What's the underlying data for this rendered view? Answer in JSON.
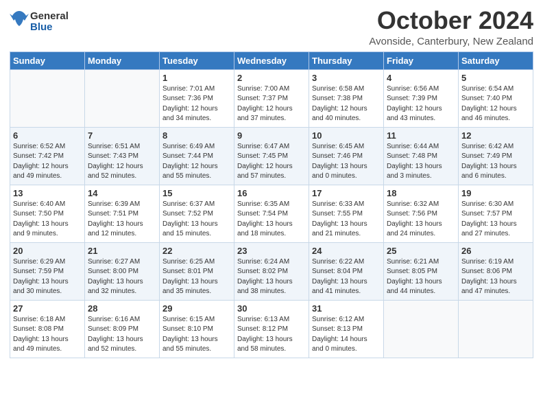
{
  "logo": {
    "text_general": "General",
    "text_blue": "Blue"
  },
  "header": {
    "month": "October 2024",
    "location": "Avonside, Canterbury, New Zealand"
  },
  "weekdays": [
    "Sunday",
    "Monday",
    "Tuesday",
    "Wednesday",
    "Thursday",
    "Friday",
    "Saturday"
  ],
  "weeks": [
    [
      {
        "day": "",
        "sunrise": "",
        "sunset": "",
        "daylight": ""
      },
      {
        "day": "",
        "sunrise": "",
        "sunset": "",
        "daylight": ""
      },
      {
        "day": "1",
        "sunrise": "Sunrise: 7:01 AM",
        "sunset": "Sunset: 7:36 PM",
        "daylight": "Daylight: 12 hours and 34 minutes."
      },
      {
        "day": "2",
        "sunrise": "Sunrise: 7:00 AM",
        "sunset": "Sunset: 7:37 PM",
        "daylight": "Daylight: 12 hours and 37 minutes."
      },
      {
        "day": "3",
        "sunrise": "Sunrise: 6:58 AM",
        "sunset": "Sunset: 7:38 PM",
        "daylight": "Daylight: 12 hours and 40 minutes."
      },
      {
        "day": "4",
        "sunrise": "Sunrise: 6:56 AM",
        "sunset": "Sunset: 7:39 PM",
        "daylight": "Daylight: 12 hours and 43 minutes."
      },
      {
        "day": "5",
        "sunrise": "Sunrise: 6:54 AM",
        "sunset": "Sunset: 7:40 PM",
        "daylight": "Daylight: 12 hours and 46 minutes."
      }
    ],
    [
      {
        "day": "6",
        "sunrise": "Sunrise: 6:52 AM",
        "sunset": "Sunset: 7:42 PM",
        "daylight": "Daylight: 12 hours and 49 minutes."
      },
      {
        "day": "7",
        "sunrise": "Sunrise: 6:51 AM",
        "sunset": "Sunset: 7:43 PM",
        "daylight": "Daylight: 12 hours and 52 minutes."
      },
      {
        "day": "8",
        "sunrise": "Sunrise: 6:49 AM",
        "sunset": "Sunset: 7:44 PM",
        "daylight": "Daylight: 12 hours and 55 minutes."
      },
      {
        "day": "9",
        "sunrise": "Sunrise: 6:47 AM",
        "sunset": "Sunset: 7:45 PM",
        "daylight": "Daylight: 12 hours and 57 minutes."
      },
      {
        "day": "10",
        "sunrise": "Sunrise: 6:45 AM",
        "sunset": "Sunset: 7:46 PM",
        "daylight": "Daylight: 13 hours and 0 minutes."
      },
      {
        "day": "11",
        "sunrise": "Sunrise: 6:44 AM",
        "sunset": "Sunset: 7:48 PM",
        "daylight": "Daylight: 13 hours and 3 minutes."
      },
      {
        "day": "12",
        "sunrise": "Sunrise: 6:42 AM",
        "sunset": "Sunset: 7:49 PM",
        "daylight": "Daylight: 13 hours and 6 minutes."
      }
    ],
    [
      {
        "day": "13",
        "sunrise": "Sunrise: 6:40 AM",
        "sunset": "Sunset: 7:50 PM",
        "daylight": "Daylight: 13 hours and 9 minutes."
      },
      {
        "day": "14",
        "sunrise": "Sunrise: 6:39 AM",
        "sunset": "Sunset: 7:51 PM",
        "daylight": "Daylight: 13 hours and 12 minutes."
      },
      {
        "day": "15",
        "sunrise": "Sunrise: 6:37 AM",
        "sunset": "Sunset: 7:52 PM",
        "daylight": "Daylight: 13 hours and 15 minutes."
      },
      {
        "day": "16",
        "sunrise": "Sunrise: 6:35 AM",
        "sunset": "Sunset: 7:54 PM",
        "daylight": "Daylight: 13 hours and 18 minutes."
      },
      {
        "day": "17",
        "sunrise": "Sunrise: 6:33 AM",
        "sunset": "Sunset: 7:55 PM",
        "daylight": "Daylight: 13 hours and 21 minutes."
      },
      {
        "day": "18",
        "sunrise": "Sunrise: 6:32 AM",
        "sunset": "Sunset: 7:56 PM",
        "daylight": "Daylight: 13 hours and 24 minutes."
      },
      {
        "day": "19",
        "sunrise": "Sunrise: 6:30 AM",
        "sunset": "Sunset: 7:57 PM",
        "daylight": "Daylight: 13 hours and 27 minutes."
      }
    ],
    [
      {
        "day": "20",
        "sunrise": "Sunrise: 6:29 AM",
        "sunset": "Sunset: 7:59 PM",
        "daylight": "Daylight: 13 hours and 30 minutes."
      },
      {
        "day": "21",
        "sunrise": "Sunrise: 6:27 AM",
        "sunset": "Sunset: 8:00 PM",
        "daylight": "Daylight: 13 hours and 32 minutes."
      },
      {
        "day": "22",
        "sunrise": "Sunrise: 6:25 AM",
        "sunset": "Sunset: 8:01 PM",
        "daylight": "Daylight: 13 hours and 35 minutes."
      },
      {
        "day": "23",
        "sunrise": "Sunrise: 6:24 AM",
        "sunset": "Sunset: 8:02 PM",
        "daylight": "Daylight: 13 hours and 38 minutes."
      },
      {
        "day": "24",
        "sunrise": "Sunrise: 6:22 AM",
        "sunset": "Sunset: 8:04 PM",
        "daylight": "Daylight: 13 hours and 41 minutes."
      },
      {
        "day": "25",
        "sunrise": "Sunrise: 6:21 AM",
        "sunset": "Sunset: 8:05 PM",
        "daylight": "Daylight: 13 hours and 44 minutes."
      },
      {
        "day": "26",
        "sunrise": "Sunrise: 6:19 AM",
        "sunset": "Sunset: 8:06 PM",
        "daylight": "Daylight: 13 hours and 47 minutes."
      }
    ],
    [
      {
        "day": "27",
        "sunrise": "Sunrise: 6:18 AM",
        "sunset": "Sunset: 8:08 PM",
        "daylight": "Daylight: 13 hours and 49 minutes."
      },
      {
        "day": "28",
        "sunrise": "Sunrise: 6:16 AM",
        "sunset": "Sunset: 8:09 PM",
        "daylight": "Daylight: 13 hours and 52 minutes."
      },
      {
        "day": "29",
        "sunrise": "Sunrise: 6:15 AM",
        "sunset": "Sunset: 8:10 PM",
        "daylight": "Daylight: 13 hours and 55 minutes."
      },
      {
        "day": "30",
        "sunrise": "Sunrise: 6:13 AM",
        "sunset": "Sunset: 8:12 PM",
        "daylight": "Daylight: 13 hours and 58 minutes."
      },
      {
        "day": "31",
        "sunrise": "Sunrise: 6:12 AM",
        "sunset": "Sunset: 8:13 PM",
        "daylight": "Daylight: 14 hours and 0 minutes."
      },
      {
        "day": "",
        "sunrise": "",
        "sunset": "",
        "daylight": ""
      },
      {
        "day": "",
        "sunrise": "",
        "sunset": "",
        "daylight": ""
      }
    ]
  ]
}
